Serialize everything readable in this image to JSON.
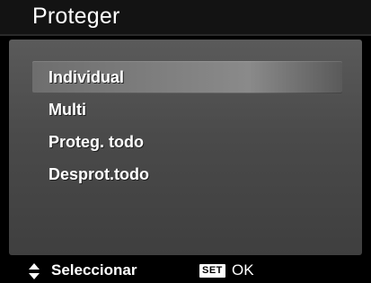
{
  "header": {
    "title": "Proteger"
  },
  "menu": {
    "items": [
      {
        "label": "Individual",
        "selected": true
      },
      {
        "label": "Multi",
        "selected": false
      },
      {
        "label": "Proteg. todo",
        "selected": false
      },
      {
        "label": "Desprot.todo",
        "selected": false
      }
    ]
  },
  "status_bar": {
    "select_icon": "up-down-arrows-icon",
    "select_label": "Seleccionar",
    "set_badge": "SET",
    "ok_label": "OK"
  },
  "colors": {
    "background": "#000000",
    "panel": "#4a4a4a",
    "highlight": "#7c7c7c",
    "text": "#ffffff"
  }
}
